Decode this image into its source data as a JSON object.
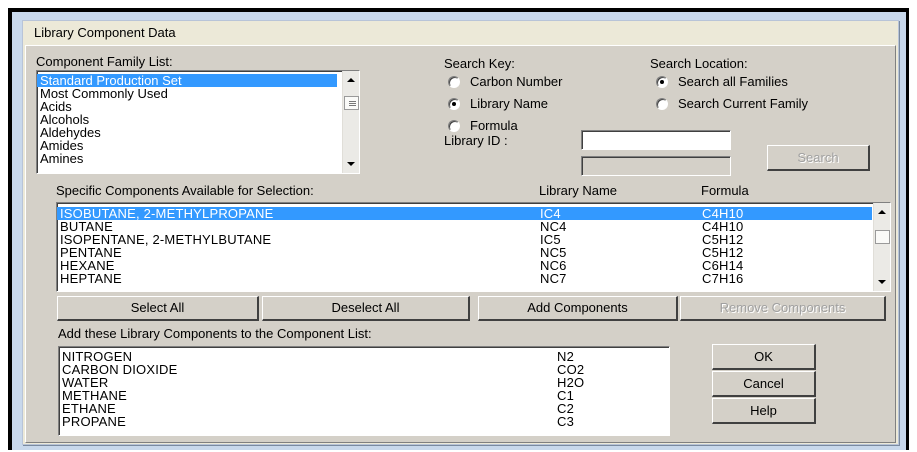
{
  "window": {
    "title": "Library Component Data"
  },
  "family": {
    "label": "Component Family List:",
    "items": [
      "Standard Production Set",
      "Most Commonly Used",
      "Acids",
      "Alcohols",
      "Aldehydes",
      "Amides",
      "Amines"
    ],
    "selected_index": 0
  },
  "search_key": {
    "label": "Search Key:",
    "options": [
      "Carbon Number",
      "Library Name",
      "Formula"
    ],
    "selected_index": 1
  },
  "search_location": {
    "label": "Search Location:",
    "options": [
      "Search all Families",
      "Search Current Family"
    ],
    "selected_index": 0
  },
  "library_id": {
    "label": "Library ID :",
    "value": "",
    "value2": ""
  },
  "search_button": "Search",
  "available": {
    "label": "Specific Components Available for Selection:",
    "col_library_name": "Library Name",
    "col_formula": "Formula",
    "rows": [
      {
        "name": "ISOBUTANE, 2-METHYLPROPANE",
        "library": "IC4",
        "formula": "C4H10"
      },
      {
        "name": "BUTANE",
        "library": "NC4",
        "formula": "C4H10"
      },
      {
        "name": "ISOPENTANE, 2-METHYLBUTANE",
        "library": "IC5",
        "formula": "C5H12"
      },
      {
        "name": "PENTANE",
        "library": "NC5",
        "formula": "C5H12"
      },
      {
        "name": "HEXANE",
        "library": "NC6",
        "formula": "C6H14"
      },
      {
        "name": "HEPTANE",
        "library": "NC7",
        "formula": "C7H16"
      }
    ],
    "selected_index": 0
  },
  "buttons": {
    "select_all": "Select All",
    "deselect_all": "Deselect All",
    "add_components": "Add Components",
    "remove_components": "Remove Components",
    "ok": "OK",
    "cancel": "Cancel",
    "help": "Help"
  },
  "added": {
    "label": "Add these Library Components to the Component List:",
    "rows": [
      {
        "name": "NITROGEN",
        "library": "N2"
      },
      {
        "name": "CARBON DIOXIDE",
        "library": "CO2"
      },
      {
        "name": "WATER",
        "library": "H2O"
      },
      {
        "name": "METHANE",
        "library": "C1"
      },
      {
        "name": "ETHANE",
        "library": "C2"
      },
      {
        "name": "PROPANE",
        "library": "C3"
      }
    ]
  },
  "colors": {
    "selection": "#3399ff",
    "face": "#d4d0c8",
    "frame": "#c8d8ec"
  },
  "icons": {
    "scroll_up": "chevron-up-icon",
    "scroll_down": "chevron-down-icon",
    "scroll_thumb": "scroll-thumb-grip-icon"
  }
}
